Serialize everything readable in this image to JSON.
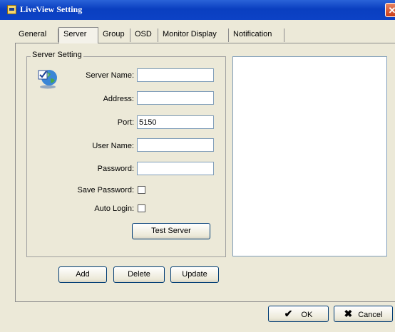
{
  "window": {
    "title": "LiveView Setting",
    "close_glyph": "✕"
  },
  "tabs": [
    {
      "label": "General"
    },
    {
      "label": "Server",
      "active": true
    },
    {
      "label": "Group"
    },
    {
      "label": "OSD"
    },
    {
      "label": "Monitor Display"
    },
    {
      "label": "Notification"
    }
  ],
  "server_setting": {
    "legend": "Server Setting",
    "icon": "server-globe-icon",
    "fields": {
      "server_name": {
        "label": "Server Name:",
        "value": ""
      },
      "address": {
        "label": "Address:",
        "value": ""
      },
      "port": {
        "label": "Port:",
        "value": "5150"
      },
      "user_name": {
        "label": "User Name:",
        "value": ""
      },
      "password": {
        "label": "Password:",
        "value": ""
      }
    },
    "save_password": {
      "label": "Save Password:",
      "checked": false
    },
    "auto_login": {
      "label": "Auto Login:",
      "checked": false
    },
    "test_server_label": "Test Server"
  },
  "actions": {
    "add": "Add",
    "delete": "Delete",
    "update": "Update"
  },
  "dialog": {
    "ok": "OK",
    "cancel": "Cancel",
    "ok_icon": "checkmark-icon",
    "cancel_icon": "x-icon"
  }
}
